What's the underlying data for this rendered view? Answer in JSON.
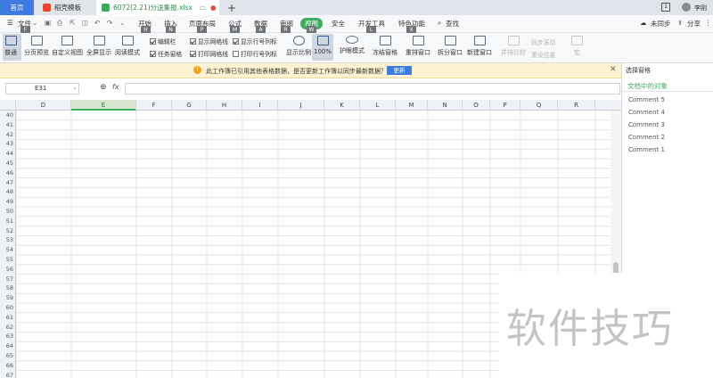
{
  "title_bar": {
    "tabs": [
      {
        "label": "首页"
      },
      {
        "label": "稻壳模板"
      },
      {
        "label": "6072(2.21)分送集报.xlsx"
      }
    ],
    "add_tab": "+",
    "user": "李刚",
    "window_badge": "1"
  },
  "menu": {
    "file_label": "文件",
    "file_key": "F",
    "items": [
      {
        "label": "开始",
        "key": "H"
      },
      {
        "label": "插入",
        "key": "N"
      },
      {
        "label": "页面布局",
        "key": "P"
      },
      {
        "label": "公式",
        "key": "M"
      },
      {
        "label": "数据",
        "key": "A"
      },
      {
        "label": "审阅",
        "key": "R"
      },
      {
        "label": "视图",
        "key": "W"
      },
      {
        "label": "安全",
        "key": ""
      },
      {
        "label": "开发工具",
        "key": "L"
      },
      {
        "label": "特色功能",
        "key": "X"
      }
    ],
    "search_label": "查找",
    "sync_label": "未同步",
    "share_label": "分享"
  },
  "ribbon": {
    "normal": "普通",
    "page_break": "分页预览",
    "custom_view": "自定义视图",
    "fullscreen": "全屏显示",
    "reading_mode": "阅读模式",
    "checks": [
      {
        "label": "编辑栏",
        "checked": true
      },
      {
        "label": "显示网格线",
        "checked": true
      },
      {
        "label": "显示行号列标",
        "checked": true
      },
      {
        "label": "任务窗格",
        "checked": true
      },
      {
        "label": "打印网格线",
        "checked": true
      },
      {
        "label": "打印行号列标",
        "checked": false
      }
    ],
    "zoom": "显示比例",
    "zoom100": "100%",
    "eye_mode": "护眼模式",
    "freeze": "冻结窗格",
    "rearrange": "重排窗口",
    "split": "拆分窗口",
    "new_window": "新建窗口",
    "side_by_side": "并排比较",
    "sync_scroll": "同步滚动",
    "reset_pos": "重设位置",
    "macro": "宏"
  },
  "notification": {
    "text": "此工作簿已引用其他表格数据，是否更新工作簿以同步最新数据？",
    "button": "更新"
  },
  "formula_bar": {
    "name_box": "E31",
    "fx": "fx",
    "value": ""
  },
  "grid": {
    "columns": [
      "D",
      "E",
      "F",
      "G",
      "H",
      "I",
      "J",
      "K",
      "L",
      "M",
      "N",
      "O",
      "P",
      "Q",
      "R"
    ],
    "selected_column": "E",
    "rows": [
      40,
      41,
      42,
      43,
      44,
      45,
      46,
      47,
      48,
      49,
      50,
      51,
      52,
      53,
      54,
      55,
      56,
      57,
      58,
      59,
      60,
      61,
      62,
      63,
      64,
      65,
      66,
      67
    ]
  },
  "side_panel": {
    "title": "选择窗格",
    "section": "文档中的对象",
    "items": [
      "Comment 5",
      "Comment 4",
      "Comment 3",
      "Comment 2",
      "Comment 1"
    ]
  },
  "watermark": "软件技巧",
  "colors": {
    "accent_green": "#3eaa5e",
    "home_tab_blue": "#3d7be0",
    "notify_bg": "#fdf3d2",
    "update_button": "#3d7be0"
  }
}
